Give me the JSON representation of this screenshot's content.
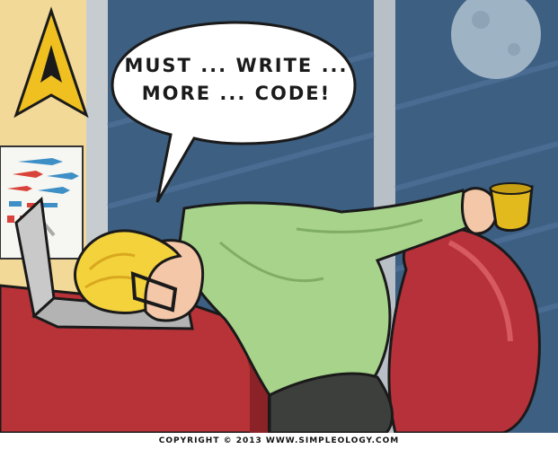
{
  "speech": {
    "line1": "MUST ... WRITE ...",
    "line2": "MORE ... CODE!"
  },
  "footer": {
    "copyright": "COPYRIGHT © 2013 WWW.SIMPLEOLOGY.COM"
  },
  "colors": {
    "wall": "#f3d998",
    "window_frame": "#c7ccd1",
    "night_sky": "#3d5f82",
    "moon": "#9eb3c4",
    "starfleet_gold": "#f0c020",
    "desk_red": "#b83338",
    "chair_red": "#b7313a",
    "shirt_green": "#a8d38a",
    "hair_yellow": "#f4d23c",
    "mug_yellow": "#e2ba1e",
    "laptop_gray": "#c9c9c9"
  },
  "icons": [
    "starfleet-delta-icon",
    "spaceship-poster",
    "moon",
    "coffee-mug",
    "laptop"
  ]
}
